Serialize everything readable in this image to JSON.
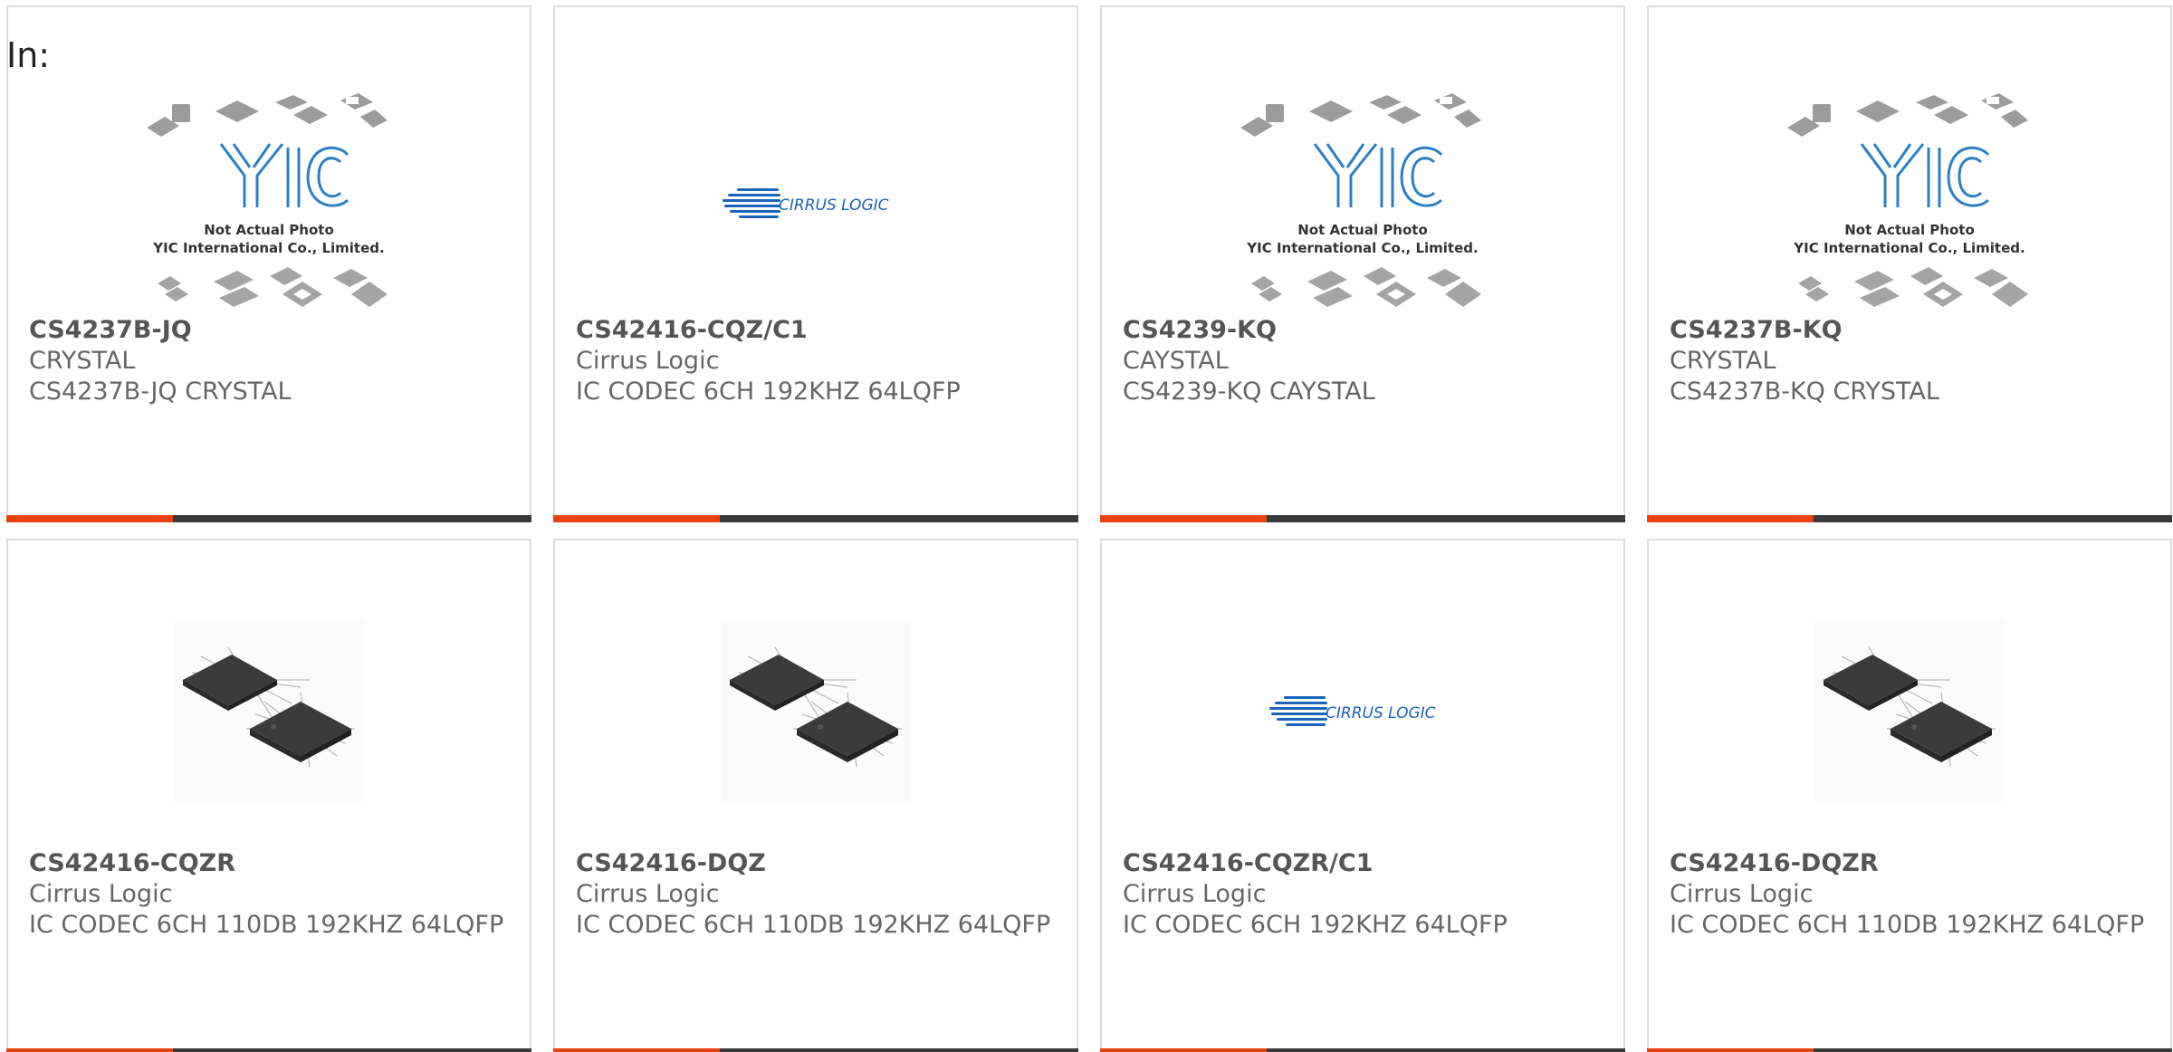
{
  "header": {
    "label": "In:"
  },
  "colors": {
    "accent": "#e8430f",
    "bar": "#3a3a3a",
    "cirrus_blue": "#1a63b8",
    "yic_blue": "#2a7fc4"
  },
  "products": [
    {
      "part_number": "CS4237B-JQ",
      "manufacturer": "CRYSTAL",
      "description": "CS4237B-JQ CRYSTAL",
      "image": {
        "type": "yic-placeholder",
        "logo_text": "YIC",
        "caption_line1": "Not Actual Photo",
        "caption_line2": "YIC International Co., Limited."
      }
    },
    {
      "part_number": "CS42416-CQZ/C1",
      "manufacturer": "Cirrus Logic",
      "description": "IC CODEC 6CH 192KHZ 64LQFP",
      "image": {
        "type": "cirrus-logo",
        "logo_text": "CIRRUS LOGIC"
      }
    },
    {
      "part_number": "CS4239-KQ",
      "manufacturer": "CAYSTAL",
      "description": "CS4239-KQ CAYSTAL",
      "image": {
        "type": "yic-placeholder",
        "logo_text": "YIC",
        "caption_line1": "Not Actual Photo",
        "caption_line2": "YIC International Co., Limited."
      }
    },
    {
      "part_number": "CS4237B-KQ",
      "manufacturer": "CRYSTAL",
      "description": "CS4237B-KQ CRYSTAL",
      "image": {
        "type": "yic-placeholder",
        "logo_text": "YIC",
        "caption_line1": "Not Actual Photo",
        "caption_line2": "YIC International Co., Limited."
      }
    },
    {
      "part_number": "CS42416-CQZR",
      "manufacturer": "Cirrus Logic",
      "description": "IC CODEC 6CH 110DB 192KHZ 64LQFP",
      "image": {
        "type": "chip-photo"
      }
    },
    {
      "part_number": "CS42416-DQZ",
      "manufacturer": "Cirrus Logic",
      "description": "IC CODEC 6CH 110DB 192KHZ 64LQFP",
      "image": {
        "type": "chip-photo"
      }
    },
    {
      "part_number": "CS42416-CQZR/C1",
      "manufacturer": "Cirrus Logic",
      "description": "IC CODEC 6CH 192KHZ 64LQFP",
      "image": {
        "type": "cirrus-logo",
        "logo_text": "CIRRUS LOGIC"
      }
    },
    {
      "part_number": "CS42416-DQZR",
      "manufacturer": "Cirrus Logic",
      "description": "IC CODEC 6CH 110DB 192KHZ 64LQFP",
      "image": {
        "type": "chip-photo"
      }
    }
  ]
}
